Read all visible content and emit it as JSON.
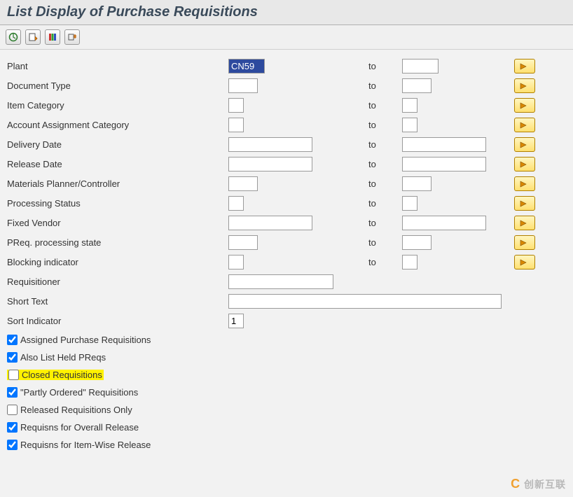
{
  "title": "List Display of Purchase Requisitions",
  "toolbar": {
    "execute": "execute",
    "getVariant": "get-variant",
    "dynamicSel": "dynamic-selections",
    "allSel": "all-selections"
  },
  "labels": {
    "to": "to"
  },
  "fields": {
    "plant": {
      "label": "Plant",
      "from": "CN59",
      "to": "",
      "fromW": "w-sm",
      "toW": "w-sm",
      "range": true
    },
    "docType": {
      "label": "Document Type",
      "from": "",
      "to": "",
      "fromW": "w-xs",
      "toW": "w-xs",
      "range": true
    },
    "itemCat": {
      "label": "Item Category",
      "from": "",
      "to": "",
      "fromW": "w-tiny",
      "toW": "w-tiny",
      "range": true
    },
    "acctAssign": {
      "label": "Account Assignment Category",
      "from": "",
      "to": "",
      "fromW": "w-tiny",
      "toW": "w-tiny",
      "range": true
    },
    "delivDate": {
      "label": "Delivery Date",
      "from": "",
      "to": "",
      "fromW": "w-md",
      "toW": "w-md",
      "range": true
    },
    "relDate": {
      "label": "Release Date",
      "from": "",
      "to": "",
      "fromW": "w-md",
      "toW": "w-md",
      "range": true
    },
    "mrp": {
      "label": "Materials Planner/Controller",
      "from": "",
      "to": "",
      "fromW": "w-xs",
      "toW": "w-xs",
      "range": true
    },
    "procStat": {
      "label": "Processing Status",
      "from": "",
      "to": "",
      "fromW": "w-tiny",
      "toW": "w-tiny",
      "range": true
    },
    "fixVendor": {
      "label": "Fixed Vendor",
      "from": "",
      "to": "",
      "fromW": "w-md",
      "toW": "w-md",
      "range": true
    },
    "preqState": {
      "label": "PReq. processing state",
      "from": "",
      "to": "",
      "fromW": "w-xs",
      "toW": "w-xs",
      "range": true
    },
    "blockInd": {
      "label": "Blocking indicator",
      "from": "",
      "to": "",
      "fromW": "w-tiny",
      "toW": "w-tiny",
      "range": true
    },
    "requisitioner": {
      "label": "Requisitioner",
      "from": "",
      "fromW": "w-lg",
      "range": false
    },
    "shortText": {
      "label": "Short Text",
      "from": "",
      "fromW": "w-shorttext",
      "range": false
    },
    "sortInd": {
      "label": "Sort Indicator",
      "from": "1",
      "fromW": "w-tiny",
      "range": false
    }
  },
  "checks": {
    "assignedPR": {
      "label": "Assigned Purchase Requisitions",
      "checked": true
    },
    "alsoHeld": {
      "label": "Also List Held PReqs",
      "checked": true
    },
    "closed": {
      "label": "Closed Requisitions",
      "checked": false,
      "highlight": true
    },
    "partly": {
      "label": "\"Partly Ordered\" Requisitions",
      "checked": true
    },
    "releasedOnly": {
      "label": "Released Requisitions Only",
      "checked": false
    },
    "overall": {
      "label": "Requisns for Overall Release",
      "checked": true
    },
    "itemwise": {
      "label": "Requisns for Item-Wise Release",
      "checked": true
    }
  },
  "watermark": {
    "brand": "创新互联",
    "icon": "C"
  }
}
